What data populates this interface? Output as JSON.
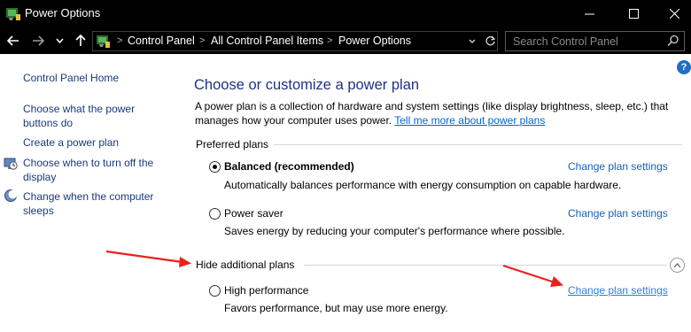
{
  "window": {
    "title": "Power Options",
    "minimize_glyph": "—",
    "close_glyph": "✕"
  },
  "address": {
    "breadcrumbs": [
      "Control Panel",
      "All Control Panel Items",
      "Power Options"
    ]
  },
  "search": {
    "placeholder": "Search Control Panel"
  },
  "sidebar": {
    "home": "Control Panel Home",
    "items": [
      "Choose what the power buttons do",
      "Create a power plan",
      "Choose when to turn off the display",
      "Change when the computer sleeps"
    ],
    "item_icons": [
      "",
      "",
      "display-clock-icon",
      "moon-icon"
    ]
  },
  "main": {
    "title": "Choose or customize a power plan",
    "intro": "A power plan is a collection of hardware and system settings (like display brightness, sleep, etc.) that manages how your computer uses power.",
    "intro_link": "Tell me more about power plans",
    "preferred_header": "Preferred plans",
    "additional_header": "Hide additional plans",
    "plans": [
      {
        "name": "Balanced (recommended)",
        "desc": "Automatically balances performance with energy consumption on capable hardware.",
        "link": "Change plan settings",
        "selected": true
      },
      {
        "name": "Power saver",
        "desc": "Saves energy by reducing your computer's performance where possible.",
        "link": "Change plan settings",
        "selected": false
      },
      {
        "name": "High performance",
        "desc": "Favors performance, but may use more energy.",
        "link": "Change plan settings",
        "selected": false
      }
    ]
  },
  "help": {
    "label": "?"
  },
  "colors": {
    "titlebar": "#000000",
    "heading": "#1e3287",
    "link": "#1a5fb4",
    "annotation_arrow": "#e8211b"
  }
}
